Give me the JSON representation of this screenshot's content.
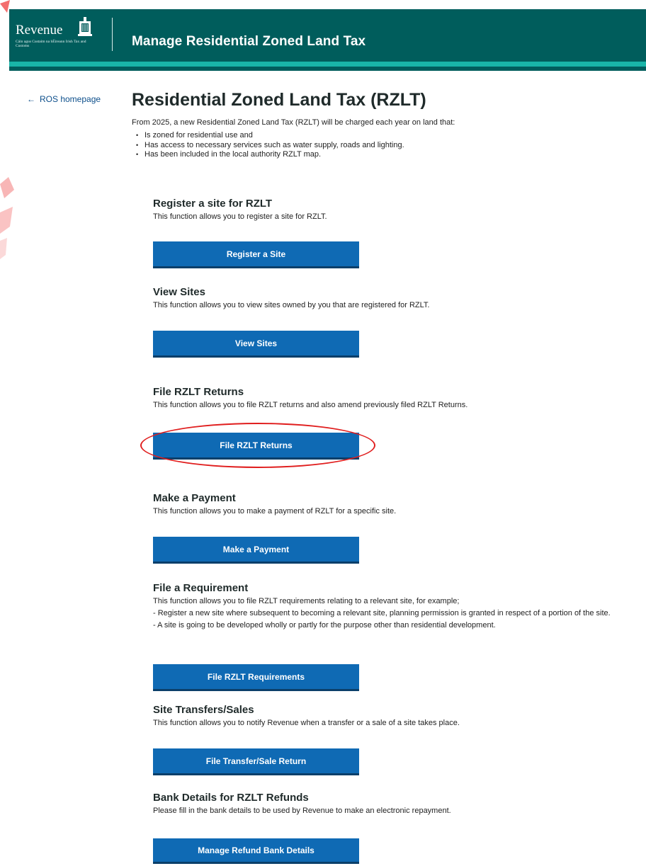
{
  "header": {
    "logo_word": "Revenue",
    "logo_subtitle": "Cáin agus Custaim na hÉireann Irish Tax and Customs",
    "title": "Manage Residential Zoned Land Tax"
  },
  "nav": {
    "back_label": "ROS homepage"
  },
  "page": {
    "title": "Residential Zoned Land Tax (RZLT)",
    "intro": "From 2025, a new Residential Zoned Land Tax (RZLT) will be charged each year on land that:",
    "bullets": [
      "Is zoned for residential use and",
      "Has access to necessary services such as water supply, roads and lighting.",
      "Has been included in the local authority RZLT map."
    ]
  },
  "sections": [
    {
      "heading": "Register a site for RZLT",
      "desc": "This function allows you to register a site for RZLT.",
      "button": "Register a Site"
    },
    {
      "heading": "View Sites",
      "desc": "This function allows you to view sites owned by you that are registered for RZLT.",
      "button": "View Sites"
    },
    {
      "heading": "File RZLT Returns",
      "desc": "This function allows you to file RZLT returns and also amend previously filed RZLT Returns.",
      "button": "File RZLT Returns"
    },
    {
      "heading": "Make a Payment",
      "desc": "This function allows you to make a payment of RZLT for a specific site.",
      "button": "Make a Payment"
    },
    {
      "heading": "File a Requirement",
      "desc": "This function allows you to file RZLT requirements relating to a relevant site, for example;",
      "desc2": "- Register a new site where subsequent to becoming a relevant site, planning permission is granted in respect of a portion of the site.",
      "desc3": "- A site is going to be developed wholly or partly for the purpose other than residential development.",
      "button": "File RZLT Requirements"
    },
    {
      "heading": "Site Transfers/Sales",
      "desc": "This function allows you to notify Revenue when a transfer or a sale of a site takes place.",
      "button": "File Transfer/Sale Return"
    },
    {
      "heading": "Bank Details for RZLT Refunds",
      "desc": "Please fill in the bank details to be used by Revenue to make an electronic repayment.",
      "button": "Manage Refund Bank Details"
    }
  ],
  "colors": {
    "header_bg": "#005d5c",
    "accent": "#19b5a8",
    "button_bg": "#0f6ab4",
    "highlight": "#e01e1e"
  }
}
